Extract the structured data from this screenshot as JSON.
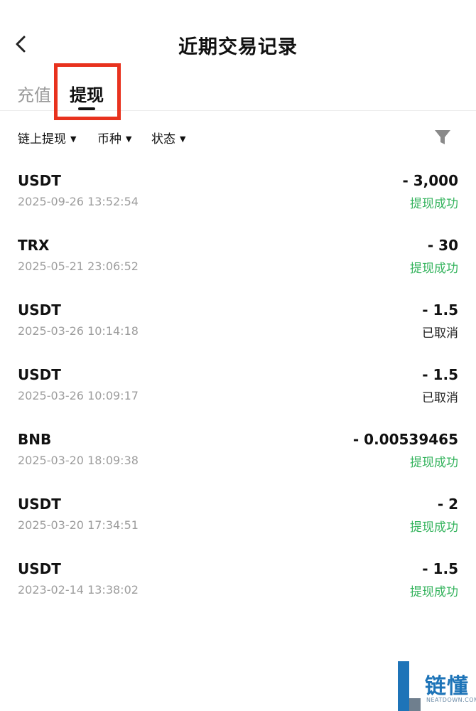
{
  "header": {
    "title": "近期交易记录",
    "back_icon": "chevron-left-icon"
  },
  "tabs": [
    {
      "label": "充值",
      "active": false
    },
    {
      "label": "提现",
      "active": true
    }
  ],
  "filters": {
    "items": [
      {
        "label": "链上提现"
      },
      {
        "label": "币种"
      },
      {
        "label": "状态"
      }
    ],
    "caret": "▼",
    "funnel_icon": "filter-funnel-icon"
  },
  "transactions": [
    {
      "coin": "USDT",
      "time": "2025-09-26 13:52:54",
      "amount": "- 3,000",
      "status": "提现成功",
      "status_type": "success"
    },
    {
      "coin": "TRX",
      "time": "2025-05-21 23:06:52",
      "amount": "- 30",
      "status": "提现成功",
      "status_type": "success"
    },
    {
      "coin": "USDT",
      "time": "2025-03-26 10:14:18",
      "amount": "- 1.5",
      "status": "已取消",
      "status_type": "cancelled"
    },
    {
      "coin": "USDT",
      "time": "2025-03-26 10:09:17",
      "amount": "- 1.5",
      "status": "已取消",
      "status_type": "cancelled"
    },
    {
      "coin": "BNB",
      "time": "2025-03-20 18:09:38",
      "amount": "- 0.00539465",
      "status": "提现成功",
      "status_type": "success"
    },
    {
      "coin": "USDT",
      "time": "2025-03-20 17:34:51",
      "amount": "- 2",
      "status": "提现成功",
      "status_type": "success"
    },
    {
      "coin": "USDT",
      "time": "2023-02-14 13:38:02",
      "amount": "- 1.5",
      "status": "提现成功",
      "status_type": "success"
    }
  ],
  "watermark": {
    "text": "链懂",
    "sub": "NEATDOWN.COM"
  },
  "colors": {
    "success": "#33b35c",
    "highlight": "#e8321e",
    "brand": "#1e74b8"
  }
}
